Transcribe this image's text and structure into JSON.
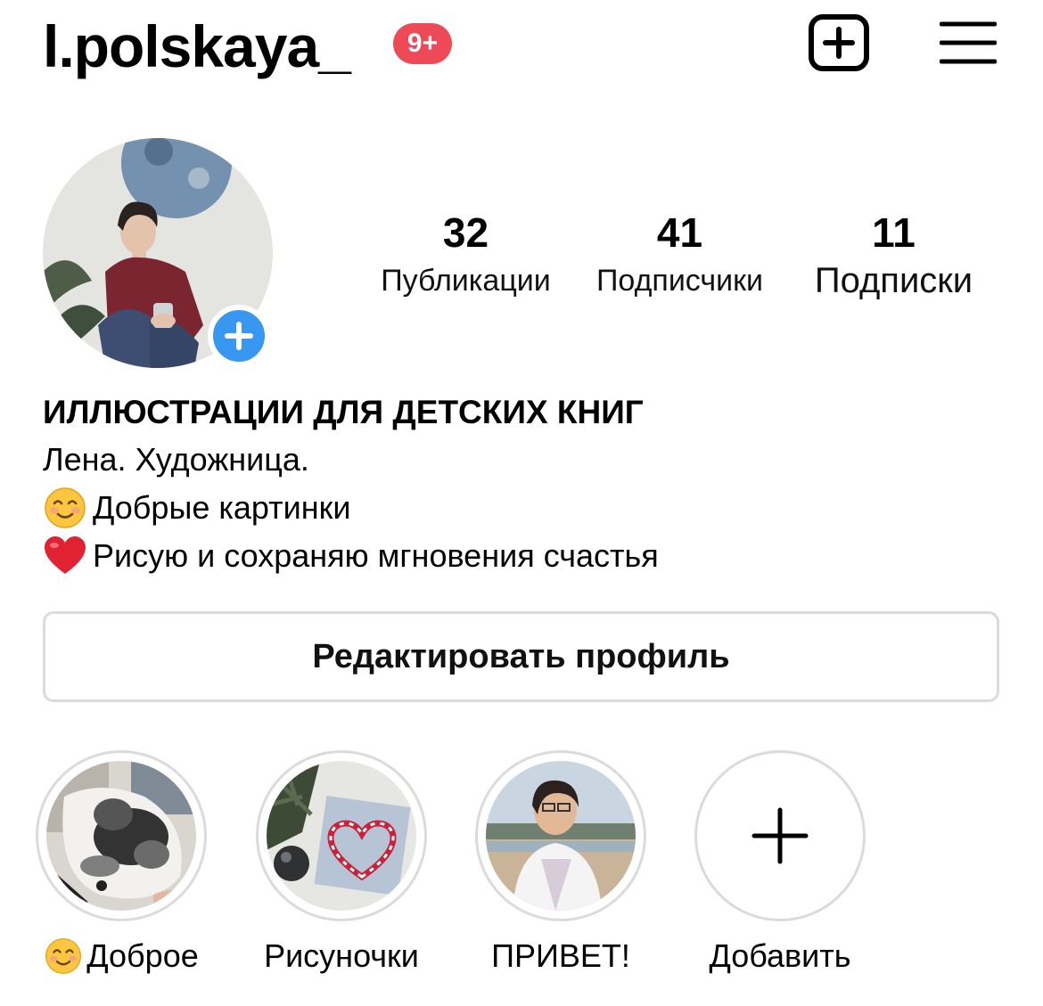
{
  "header": {
    "username": "l.polskaya_",
    "notification_badge": "9+",
    "new_post_icon": "plus-square-icon",
    "menu_icon": "hamburger-menu-icon"
  },
  "profile": {
    "avatar_icon": "profile-photo",
    "add_story_icon": "plus-icon",
    "stats": {
      "posts": {
        "value": "32",
        "label": "Публикации"
      },
      "followers": {
        "value": "41",
        "label": "Подписчики"
      },
      "following": {
        "value": "11",
        "label": "Подписки"
      }
    }
  },
  "bio": {
    "title": "ИЛЛЮСТРАЦИИ ДЛЯ ДЕТСКИХ КНИГ",
    "lines": [
      {
        "emoji": "",
        "text": "Лена. Художница."
      },
      {
        "emoji": "smiling-face-icon",
        "text": "Добрые картинки"
      },
      {
        "emoji": "red-heart-icon",
        "text": "Рисую и сохраняю мгновения счастья"
      }
    ]
  },
  "actions": {
    "edit_profile_label": "Редактировать профиль"
  },
  "highlights": [
    {
      "label": "Доброе",
      "emoji": "smiling-face-icon",
      "image": "watercolor-cat-image"
    },
    {
      "label": "Рисуночки",
      "emoji": "",
      "image": "candy-cane-heart-image"
    },
    {
      "label": "ПРИВЕТ!",
      "emoji": "",
      "image": "beach-portrait-image"
    },
    {
      "label": "Добавить",
      "emoji": "",
      "image": "plus-icon"
    }
  ],
  "colors": {
    "badge_red": "#ed4956",
    "story_blue": "#3897f0",
    "border_gray": "#dbdbdb"
  }
}
